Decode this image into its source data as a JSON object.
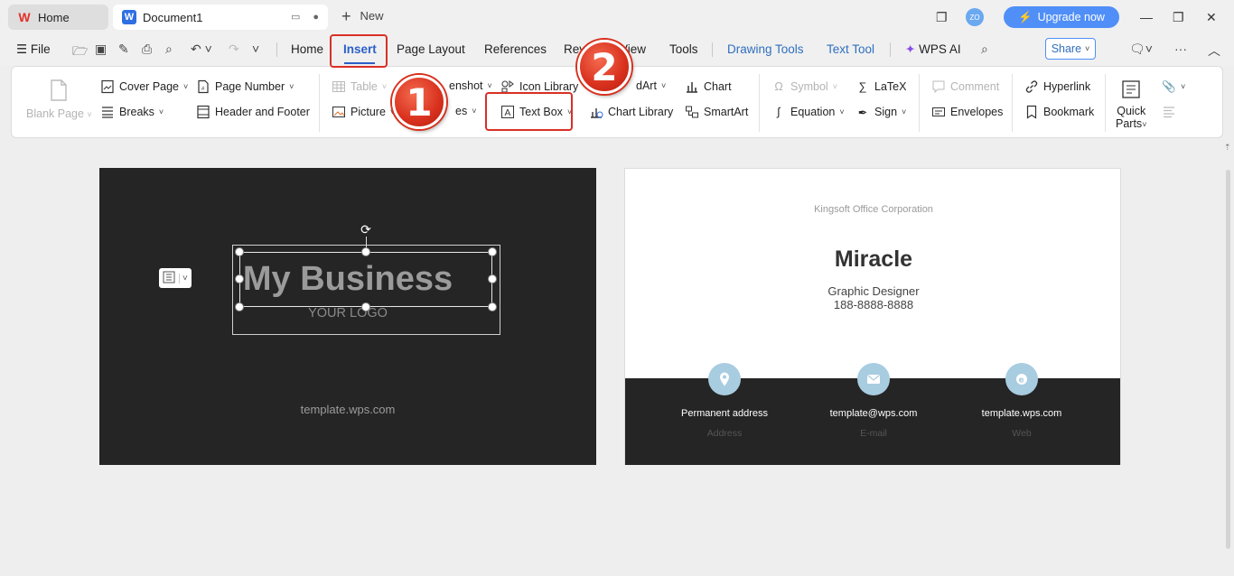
{
  "titlebar": {
    "tab_home": "Home",
    "tab_doc": "Document1",
    "new_tab": "New",
    "avatar_initials": "ZO",
    "upgrade": "Upgrade now"
  },
  "menu": {
    "file": "File",
    "tabs": [
      "Home",
      "Insert",
      "Page Layout",
      "References",
      "Review",
      "View",
      "Tools"
    ],
    "drawing_tools": "Drawing Tools",
    "text_tool": "Text Tool",
    "wps_ai": "WPS AI",
    "share": "Share"
  },
  "ribbon": {
    "blank_page": "Blank Page",
    "cover_page": "Cover Page",
    "breaks": "Breaks",
    "page_number": "Page Number",
    "header_footer": "Header and  Footer",
    "table": "Table",
    "picture": "Picture",
    "screenshot": "enshot",
    "shapes": "es",
    "icon_library": "Icon  Library",
    "text_box": "Text Box",
    "wordart": "dArt",
    "chart": "Chart",
    "chart_library": "Chart  Library",
    "smartart": "SmartArt",
    "symbol": "Symbol",
    "latex": "LaTeX",
    "equation": "Equation",
    "sign": "Sign",
    "comment": "Comment",
    "envelopes": "Envelopes",
    "hyperlink": "Hyperlink",
    "bookmark": "Bookmark",
    "quick_parts_1": "Quick",
    "quick_parts_2": "Parts"
  },
  "callouts": {
    "one": "1",
    "two": "2"
  },
  "left_page": {
    "title": "My Business",
    "logo_text": "YOUR LOGO",
    "url": "template.wps.com"
  },
  "right_page": {
    "company": "Kingsoft Office Corporation",
    "name": "Miracle",
    "role": "Graphic Designer",
    "phone": "188-8888-8888",
    "contacts": [
      {
        "value": "Permanent address",
        "label": "Address",
        "icon": "location-pin-icon"
      },
      {
        "value": "template@wps.com",
        "label": "E-mail",
        "icon": "envelope-icon"
      },
      {
        "value": "template.wps.com",
        "label": "Web",
        "icon": "browser-icon"
      }
    ]
  },
  "colors": {
    "accent": "#2a5fc9",
    "highlight": "#d93025",
    "dark_card": "#252525",
    "icon_circle": "#a8cce0"
  }
}
